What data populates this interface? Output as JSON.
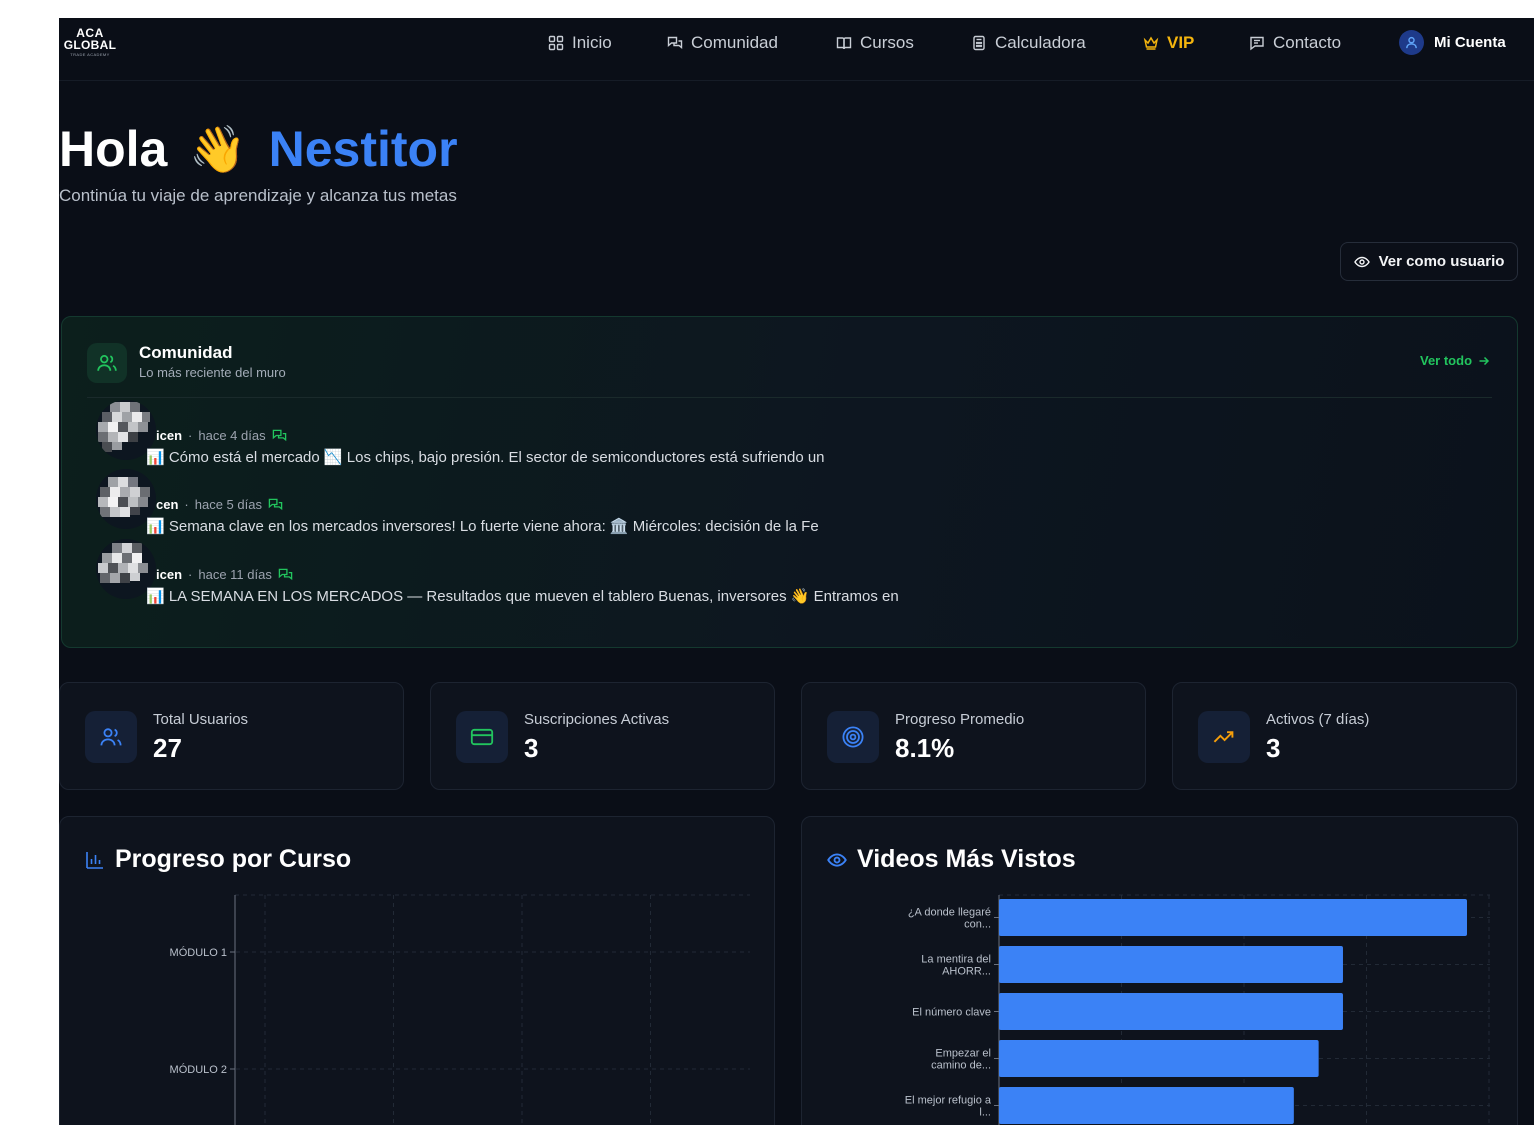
{
  "nav": {
    "logo_line1": "ACA",
    "logo_line2": "GLOBAL",
    "logo_line3": "TRADE ACADEMY",
    "items": [
      {
        "label": "Inicio",
        "icon": "grid-icon"
      },
      {
        "label": "Comunidad",
        "icon": "chat-icon"
      },
      {
        "label": "Cursos",
        "icon": "book-icon"
      },
      {
        "label": "Calculadora",
        "icon": "calculator-icon"
      },
      {
        "label": "VIP",
        "icon": "crown-icon"
      },
      {
        "label": "Contacto",
        "icon": "message-icon"
      }
    ],
    "account_label": "Mi Cuenta",
    "vip_color": "#f5b50e"
  },
  "hero": {
    "greeting": "Hola",
    "wave": "👋",
    "name": "Nestitor",
    "subtitle": "Continúa tu viaje de aprendizaje y alcanza tus metas",
    "view_as_user": "Ver como usuario"
  },
  "community": {
    "title": "Comunidad",
    "subtitle": "Lo más reciente del muro",
    "see_all": "Ver todo",
    "accent": "#22c55e",
    "posts": [
      {
        "author": "icen",
        "sep": "·",
        "time": "hace 4 días",
        "text": "📊 Cómo está el mercado 📉 Los chips, bajo presión. El sector de semiconductores está sufriendo un"
      },
      {
        "author": "cen",
        "sep": "·",
        "time": "hace 5 días",
        "text": "📊 Semana clave en los mercados inversores! Lo fuerte viene ahora: 🏛️ Miércoles: decisión de la Fe"
      },
      {
        "author": "icen",
        "sep": "·",
        "time": "hace 11 días",
        "text": "📊 LA SEMANA EN LOS MERCADOS — Resultados que mueven el tablero Buenas, inversores 👋 Entramos en"
      }
    ]
  },
  "stats": [
    {
      "label": "Total Usuarios",
      "value": "27",
      "icon": "users-icon",
      "color": "#3b82f6"
    },
    {
      "label": "Suscripciones Activas",
      "value": "3",
      "icon": "credit-card-icon",
      "color": "#22c55e"
    },
    {
      "label": "Progreso Promedio",
      "value": "8.1%",
      "icon": "target-icon",
      "color": "#3b82f6"
    },
    {
      "label": "Activos (7 días)",
      "value": "3",
      "icon": "trending-up-icon",
      "color": "#f59e0b"
    }
  ],
  "progress_card": {
    "title": "Progreso por Curso",
    "icon": "bar-chart-icon"
  },
  "videos_card": {
    "title": "Videos Más Vistos",
    "icon": "eye-icon"
  },
  "chart_data": [
    {
      "type": "bar",
      "orientation": "horizontal",
      "categories": [
        "MÓDULO 1",
        "MÓDULO 2"
      ],
      "values": [
        0,
        0
      ],
      "title": "Progreso por Curso",
      "grid": true
    },
    {
      "type": "bar",
      "orientation": "horizontal",
      "categories": [
        [
          "¿A donde llegaré",
          "con..."
        ],
        [
          "La mentira del",
          "AHORR..."
        ],
        [
          "El número clave"
        ],
        [
          "Empezar el",
          "camino de..."
        ],
        [
          "El mejor refugio a",
          "l..."
        ]
      ],
      "values": [
        1.0,
        0.735,
        0.735,
        0.683,
        0.63
      ],
      "title": "Videos Más Vistos",
      "color": "#3b82f6",
      "grid": true
    }
  ]
}
